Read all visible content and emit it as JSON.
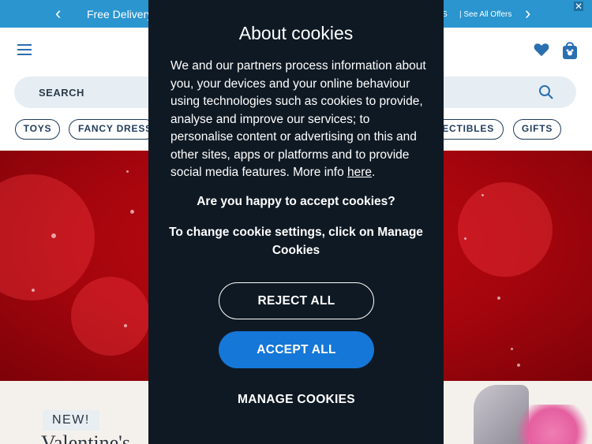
{
  "promo": {
    "left_text": "Free Delivery",
    "right_text": "S",
    "offers_link": "| See All Offers",
    "close_label": "✕"
  },
  "search": {
    "placeholder": "SEARCH"
  },
  "categories": [
    "TOYS",
    "FANCY DRESS",
    "LECTIBLES",
    "GIFTS"
  ],
  "hero": {
    "background": "#b0060f"
  },
  "bottom": {
    "badge": "NEW!",
    "title": "Valentine's"
  },
  "cookie_modal": {
    "title": "About cookies",
    "body_text": "We and our partners process information about you, your devices and your online behaviour using technologies such as cookies to provide, analyse and improve our services; to personalise content or advertising on this and other sites, apps or platforms and to provide social media features. More info ",
    "body_link": "here",
    "body_end": ".",
    "question": "Are you happy to accept cookies?",
    "settings_hint": "To change cookie settings, click on Manage Cookies",
    "reject_label": "REJECT ALL",
    "accept_label": "ACCEPT ALL",
    "manage_label": "MANAGE COOKIES"
  },
  "colors": {
    "accent_blue": "#1577d8",
    "promo_blue": "#2a95cf",
    "modal_bg": "#0f1923",
    "hero_red": "#b0060f"
  }
}
